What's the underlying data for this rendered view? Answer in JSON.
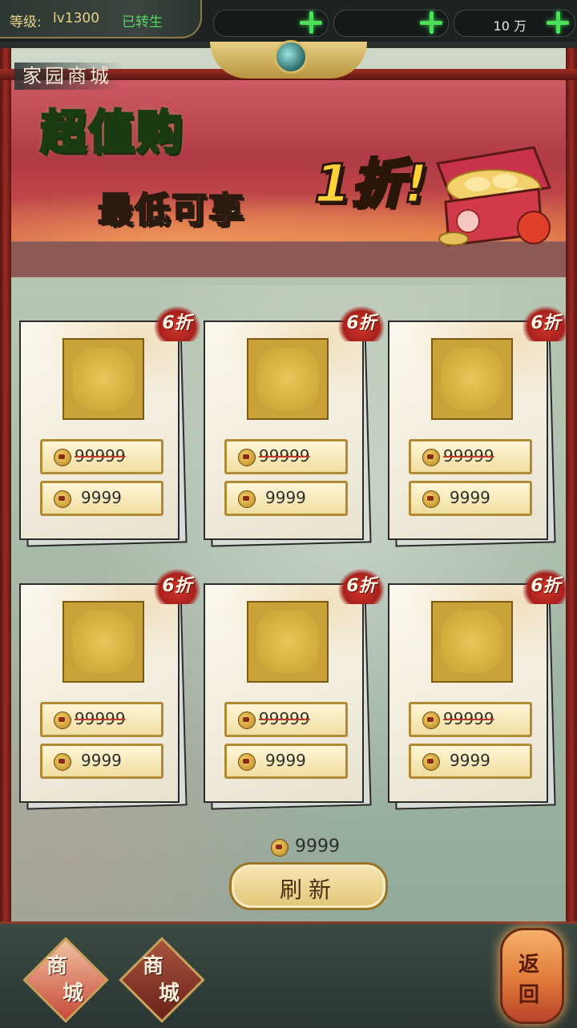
{
  "status": {
    "level_label": "等级:",
    "level_value": "lv1300",
    "rebirth": "已转生",
    "resources": [
      {
        "value": ""
      },
      {
        "value": ""
      },
      {
        "value": "10 万"
      }
    ]
  },
  "shop": {
    "title": "家园商城",
    "banner_title": "超值购",
    "banner_sub": "最低可享",
    "banner_discount": "1折!"
  },
  "goods": [
    {
      "discount": "6折",
      "original_price": "99999",
      "price": "9999"
    },
    {
      "discount": "6折",
      "original_price": "99999",
      "price": "9999"
    },
    {
      "discount": "6折",
      "original_price": "99999",
      "price": "9999"
    },
    {
      "discount": "6折",
      "original_price": "99999",
      "price": "9999"
    },
    {
      "discount": "6折",
      "original_price": "99999",
      "price": "9999"
    },
    {
      "discount": "6折",
      "original_price": "99999",
      "price": "9999"
    }
  ],
  "wallet": {
    "balance": "9999",
    "coin_icon": "coin-icon"
  },
  "refresh": {
    "label": "刷新"
  },
  "nav": {
    "tabs": [
      {
        "char1": "商",
        "char2": "城",
        "state": "active"
      },
      {
        "char1": "商",
        "char2": "城",
        "state": "normal"
      }
    ],
    "back_char1": "返",
    "back_char2": "回"
  },
  "colors": {
    "accent_green": "#4ee05c",
    "gold": "#c9a23a",
    "discount_red": "#a8201c",
    "banner_red": "#b03a46"
  }
}
